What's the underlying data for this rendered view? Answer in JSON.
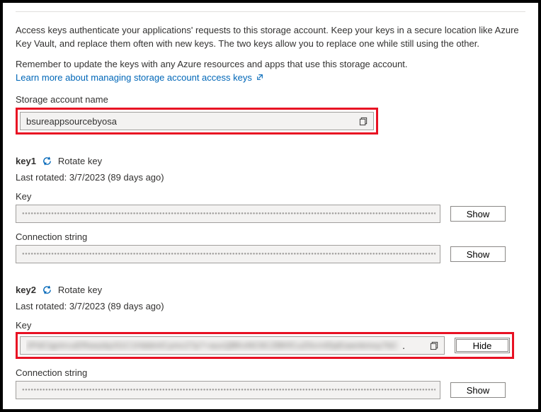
{
  "intro": {
    "p1": "Access keys authenticate your applications' requests to this storage account. Keep your keys in a secure location like Azure Key Vault, and replace them often with new keys. The two keys allow you to replace one while still using the other.",
    "p2": "Remember to update the keys with any Azure resources and apps that use this storage account.",
    "link_text": "Learn more about managing storage account access keys"
  },
  "account_name_label": "Storage account name",
  "account_name_value": "bsureappsourcebyosa",
  "rotate_label": "Rotate key",
  "key1": {
    "heading": "key1",
    "last_rotated_label": "Last rotated: 3/7/2023 (89 days ago)",
    "key_label": "Key",
    "conn_label": "Connection string",
    "show_label": "Show"
  },
  "key2": {
    "heading": "key2",
    "last_rotated_label": "Last rotated: 3/7/2023 (89 days ago)",
    "key_label": "Key",
    "conn_label": "Connection string",
    "hide_label": "Hide",
    "show_label": "Show",
    "masked_value": "2PdCIgnIrcuERwazkjc51C1HddmICymc27p7+aucQBKxNC6CZBKfCuZ0crnIDpEawnkmoy7bC"
  }
}
